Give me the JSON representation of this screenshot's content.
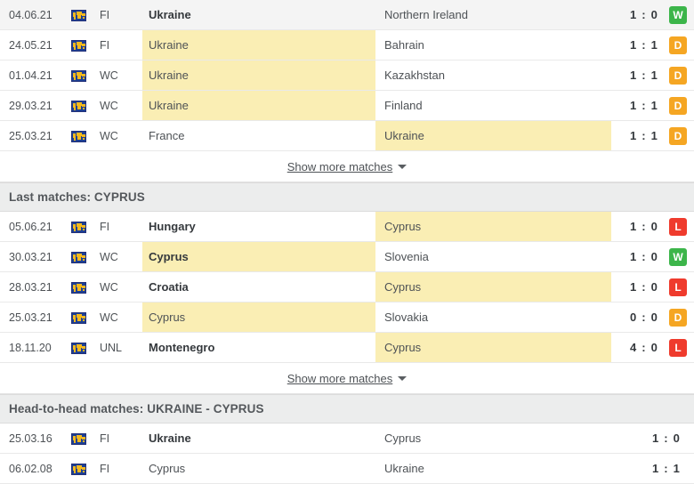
{
  "colors": {
    "highlight": "#faeeb4",
    "win": "#3cb54a",
    "draw": "#f5a623",
    "loss": "#ef3b2d",
    "header_bg": "#eceded"
  },
  "icons": {
    "competition": "world-map-icon",
    "caret": "chevron-down-icon"
  },
  "show_more": {
    "label": "Show more matches"
  },
  "sections": [
    {
      "id": "last-matches-ukraine",
      "header": null,
      "has_badges": true,
      "show_more": true,
      "rows": [
        {
          "date": "04.06.21",
          "comp": "FI",
          "home": "Ukraine",
          "away": "Northern Ireland",
          "score": "1 : 0",
          "badge": "W",
          "home_bold": true,
          "away_bold": false,
          "highlight": "none",
          "alt_bg": true
        },
        {
          "date": "24.05.21",
          "comp": "FI",
          "home": "Ukraine",
          "away": "Bahrain",
          "score": "1 : 1",
          "badge": "D",
          "home_bold": false,
          "away_bold": false,
          "highlight": "home",
          "alt_bg": false
        },
        {
          "date": "01.04.21",
          "comp": "WC",
          "home": "Ukraine",
          "away": "Kazakhstan",
          "score": "1 : 1",
          "badge": "D",
          "home_bold": false,
          "away_bold": false,
          "highlight": "home",
          "alt_bg": false
        },
        {
          "date": "29.03.21",
          "comp": "WC",
          "home": "Ukraine",
          "away": "Finland",
          "score": "1 : 1",
          "badge": "D",
          "home_bold": false,
          "away_bold": false,
          "highlight": "home",
          "alt_bg": false
        },
        {
          "date": "25.03.21",
          "comp": "WC",
          "home": "France",
          "away": "Ukraine",
          "score": "1 : 1",
          "badge": "D",
          "home_bold": false,
          "away_bold": false,
          "highlight": "away",
          "alt_bg": false
        }
      ]
    },
    {
      "id": "last-matches-cyprus",
      "header": "Last matches: CYPRUS",
      "has_badges": true,
      "show_more": true,
      "rows": [
        {
          "date": "05.06.21",
          "comp": "FI",
          "home": "Hungary",
          "away": "Cyprus",
          "score": "1 : 0",
          "badge": "L",
          "home_bold": true,
          "away_bold": false,
          "highlight": "away",
          "alt_bg": false
        },
        {
          "date": "30.03.21",
          "comp": "WC",
          "home": "Cyprus",
          "away": "Slovenia",
          "score": "1 : 0",
          "badge": "W",
          "home_bold": true,
          "away_bold": false,
          "highlight": "home",
          "alt_bg": false
        },
        {
          "date": "28.03.21",
          "comp": "WC",
          "home": "Croatia",
          "away": "Cyprus",
          "score": "1 : 0",
          "badge": "L",
          "home_bold": true,
          "away_bold": false,
          "highlight": "away",
          "alt_bg": false
        },
        {
          "date": "25.03.21",
          "comp": "WC",
          "home": "Cyprus",
          "away": "Slovakia",
          "score": "0 : 0",
          "badge": "D",
          "home_bold": false,
          "away_bold": false,
          "highlight": "home",
          "alt_bg": false
        },
        {
          "date": "18.11.20",
          "comp": "UNL",
          "home": "Montenegro",
          "away": "Cyprus",
          "score": "4 : 0",
          "badge": "L",
          "home_bold": true,
          "away_bold": false,
          "highlight": "away",
          "alt_bg": false
        }
      ]
    },
    {
      "id": "head-to-head-matches",
      "header": "Head-to-head matches: UKRAINE - CYPRUS",
      "has_badges": false,
      "show_more": false,
      "rows": [
        {
          "date": "25.03.16",
          "comp": "FI",
          "home": "Ukraine",
          "away": "Cyprus",
          "score": "1 : 0",
          "badge": null,
          "home_bold": true,
          "away_bold": false,
          "highlight": "none",
          "alt_bg": false
        },
        {
          "date": "06.02.08",
          "comp": "FI",
          "home": "Cyprus",
          "away": "Ukraine",
          "score": "1 : 1",
          "badge": null,
          "home_bold": false,
          "away_bold": false,
          "highlight": "none",
          "alt_bg": false
        }
      ]
    }
  ]
}
